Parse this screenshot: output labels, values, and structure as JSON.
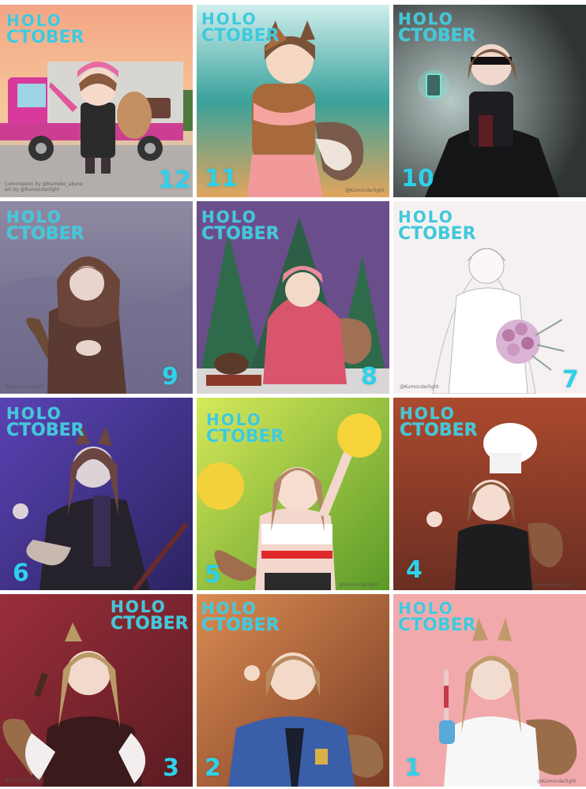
{
  "logo": {
    "line1": "HOLO",
    "line2": "CTOBER"
  },
  "panels": [
    {
      "number": "12",
      "subject": "truck-scene",
      "credit_line1": "Commission by @Kumoko_akane",
      "credit_line2": "art by @Kumocdarlight"
    },
    {
      "number": "11",
      "subject": "swimsuit-pose",
      "credit": "@Kumocdarlight"
    },
    {
      "number": "10",
      "subject": "gothic-lantern"
    },
    {
      "number": "9",
      "subject": "hooded-snow",
      "credit": "@Kumocdarlight"
    },
    {
      "number": "8",
      "subject": "blanket-forest"
    },
    {
      "number": "7",
      "subject": "bride-sketch",
      "credit": "@Kumocdarlight"
    },
    {
      "number": "6",
      "subject": "dark-coat"
    },
    {
      "number": "5",
      "subject": "cheerleader",
      "credit": "@Kumocdarlight"
    },
    {
      "number": "4",
      "subject": "chef",
      "credit": "@Kumocdarlight"
    },
    {
      "number": "3",
      "subject": "fur-stole",
      "credit": "@Kumocdarlight"
    },
    {
      "number": "2",
      "subject": "police-uniform"
    },
    {
      "number": "1",
      "subject": "nurse-syringe",
      "credit": "@Kumocdarlight"
    }
  ],
  "colors": {
    "logo": "#3fc9dc",
    "number": "#2fd1ea"
  }
}
